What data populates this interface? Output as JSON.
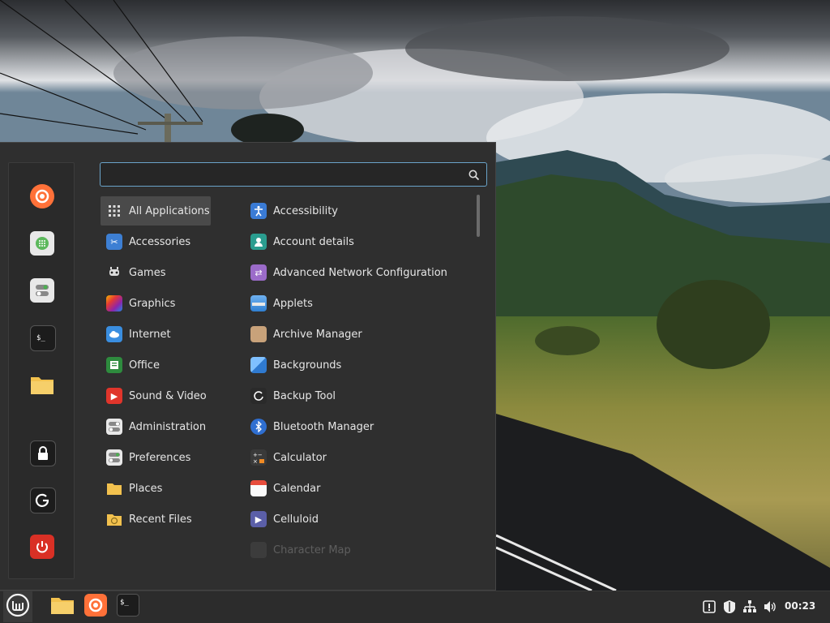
{
  "search": {
    "value": "",
    "placeholder": ""
  },
  "categories": [
    {
      "label": "All Applications",
      "icon": "grid-icon"
    },
    {
      "label": "Accessories",
      "icon": "scissors-icon"
    },
    {
      "label": "Games",
      "icon": "gamepad-icon"
    },
    {
      "label": "Graphics",
      "icon": "palette-icon"
    },
    {
      "label": "Internet",
      "icon": "cloud-icon"
    },
    {
      "label": "Office",
      "icon": "document-icon"
    },
    {
      "label": "Sound & Video",
      "icon": "play-icon"
    },
    {
      "label": "Administration",
      "icon": "toggles-icon"
    },
    {
      "label": "Preferences",
      "icon": "switches-icon"
    },
    {
      "label": "Places",
      "icon": "folder-icon"
    },
    {
      "label": "Recent Files",
      "icon": "clock-folder-icon"
    }
  ],
  "apps": [
    {
      "label": "Accessibility",
      "icon": "accessibility-icon",
      "color": "#3a7bd5"
    },
    {
      "label": "Account details",
      "icon": "user-icon",
      "color": "#2a9d8f"
    },
    {
      "label": "Advanced Network Configuration",
      "icon": "network-icon",
      "color": "#9b6bc9"
    },
    {
      "label": "Applets",
      "icon": "applets-icon",
      "color": "#4a90d9"
    },
    {
      "label": "Archive Manager",
      "icon": "archive-icon",
      "color": "#c8a27a"
    },
    {
      "label": "Backgrounds",
      "icon": "backgrounds-icon",
      "color": "#3b8ad6"
    },
    {
      "label": "Backup Tool",
      "icon": "backup-icon",
      "color": "#444444"
    },
    {
      "label": "Bluetooth Manager",
      "icon": "bluetooth-icon",
      "color": "#2f6fd1"
    },
    {
      "label": "Calculator",
      "icon": "calculator-icon",
      "color": "#555555"
    },
    {
      "label": "Calendar",
      "icon": "calendar-icon",
      "color": "#e74c3c"
    },
    {
      "label": "Celluloid",
      "icon": "celluloid-icon",
      "color": "#5b5fa8"
    },
    {
      "label": "Character Map",
      "icon": "charmap-icon",
      "color": "#666666"
    }
  ],
  "favorites": [
    {
      "name": "firefox",
      "color": "#ff7139"
    },
    {
      "name": "software-manager",
      "color": "#e8e8e8"
    },
    {
      "name": "settings",
      "color": "#e8e8e8"
    },
    {
      "name": "terminal",
      "color": "#1c1c1c"
    },
    {
      "name": "files",
      "color": "#f2c14e"
    },
    {
      "name": "lock",
      "color": "#1c1c1c"
    },
    {
      "name": "logout",
      "color": "#1c1c1c"
    },
    {
      "name": "shutdown",
      "color": "#d93025"
    }
  ],
  "panel": {
    "clock": "00:23"
  },
  "colors": {
    "accent": "#6aa3c9",
    "menu_bg": "#2f2f2f",
    "panel_bg": "#2c2c2c"
  }
}
